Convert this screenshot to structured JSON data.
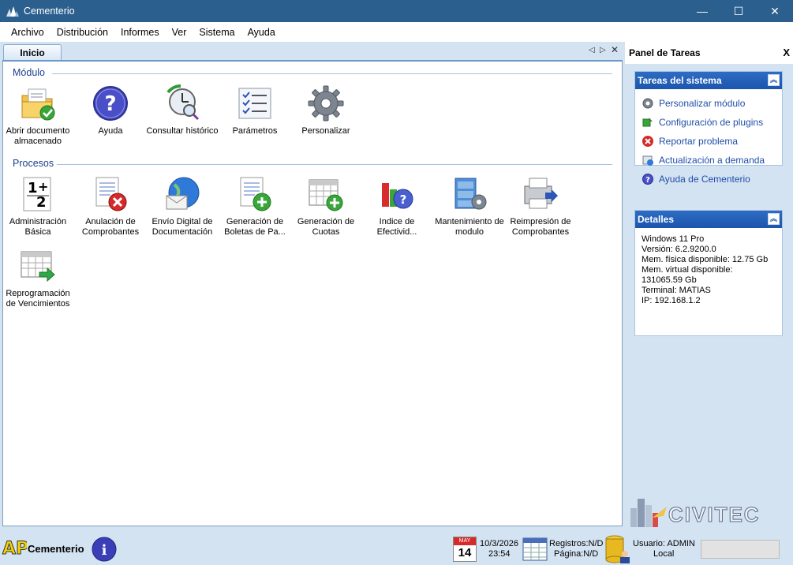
{
  "window": {
    "title": "Cementerio",
    "controls": {
      "minimize": "—",
      "maximize": "☐",
      "close": "✕"
    }
  },
  "menu": [
    "Archivo",
    "Distribución",
    "Informes",
    "Ver",
    "Sistema",
    "Ayuda"
  ],
  "tabs": {
    "active": "Inicio"
  },
  "sections": {
    "modulo": {
      "title": "Módulo",
      "items": [
        {
          "label": "Abrir documento almacenado",
          "icon": "open-document-icon"
        },
        {
          "label": "Ayuda",
          "icon": "help-icon"
        },
        {
          "label": "Consultar histórico",
          "icon": "history-clock-icon"
        },
        {
          "label": "Parámetros",
          "icon": "checklist-icon"
        },
        {
          "label": "Personalizar",
          "icon": "gear-icon"
        }
      ]
    },
    "procesos": {
      "title": "Procesos",
      "items": [
        {
          "label": "Administración Básica",
          "icon": "numbers-icon"
        },
        {
          "label": "Anulación de Comprobantes",
          "icon": "cancel-document-icon"
        },
        {
          "label": "Envío Digital de Documentación",
          "icon": "globe-mail-icon"
        },
        {
          "label": "Generación de Boletas de Pa...",
          "icon": "add-document-icon"
        },
        {
          "label": "Generación de Cuotas",
          "icon": "calendar-add-icon"
        },
        {
          "label": "Indice de Efectivid...",
          "icon": "chart-help-icon"
        },
        {
          "label": "Mantenimiento de modulo",
          "icon": "cabinet-gear-icon"
        },
        {
          "label": "Reimpresión de Comprobantes",
          "icon": "printer-icon"
        },
        {
          "label": "Reprogramación de Vencimientos",
          "icon": "calendar-arrow-icon"
        }
      ]
    }
  },
  "task_panel": {
    "title": "Panel de Tareas",
    "close": "X",
    "system_tasks": {
      "title": "Tareas del sistema",
      "items": [
        {
          "label": "Personalizar módulo",
          "icon": "gear-small-icon"
        },
        {
          "label": "Configuración de plugins",
          "icon": "plugin-icon"
        },
        {
          "label": "Reportar problema",
          "icon": "error-icon"
        },
        {
          "label": "Actualización a demanda",
          "icon": "update-icon"
        },
        {
          "label": "Ayuda de Cementerio",
          "icon": "help-small-icon"
        }
      ]
    },
    "details": {
      "title": "Detalles",
      "lines": [
        "Windows 11 Pro",
        "Versión: 6.2.9200.0",
        "Mem. física disponible: 12.75 Gb",
        "Mem. virtual disponible:",
        "131065.59 Gb",
        "Terminal: MATIAS",
        "IP: 192.168.1.2"
      ]
    },
    "brand": "CIVITEC"
  },
  "status": {
    "logo": "APi",
    "app_name": "Cementerio",
    "calendar_month": "MAY",
    "calendar_day": "14",
    "date": "10/3/2026",
    "time": "23:54",
    "registros": "Registros:N/D",
    "pagina": "Página:N/D",
    "usuario": "Usuario: ADMIN",
    "location": "Local"
  }
}
